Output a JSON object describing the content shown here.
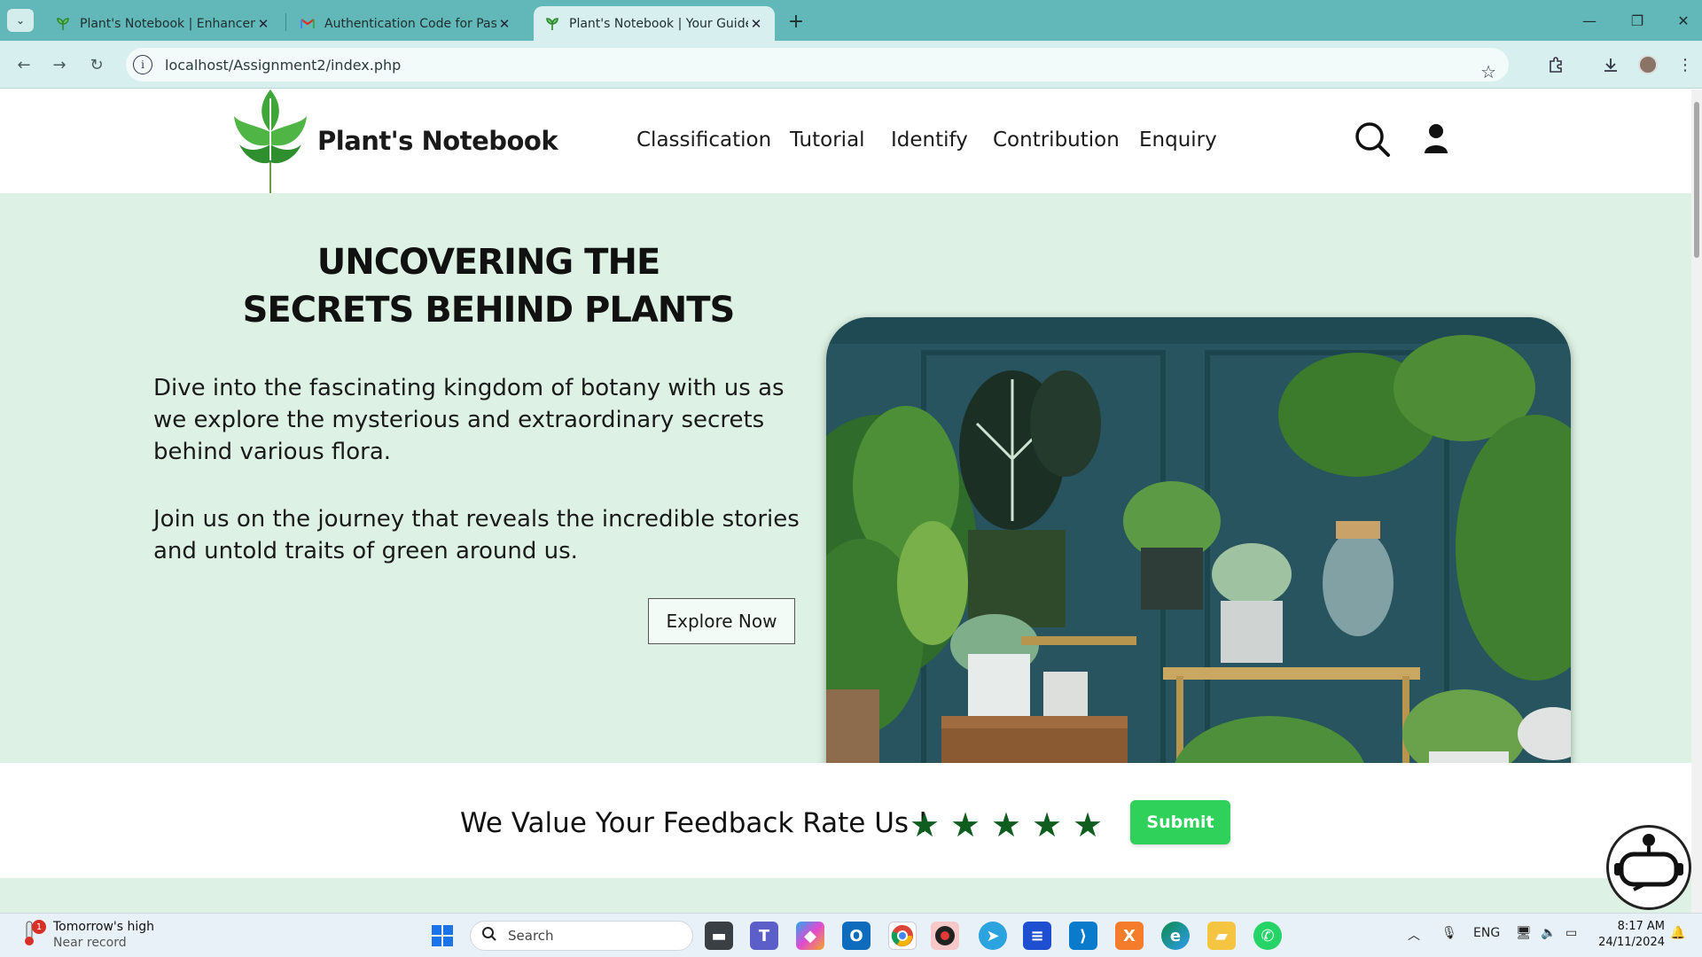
{
  "browser": {
    "tabs": [
      {
        "label": "Plant's Notebook | Enhanceme",
        "active": false,
        "icon": "plant-leaf-icon"
      },
      {
        "label": "Authentication Code for Passw",
        "active": false,
        "icon": "gmail-icon"
      },
      {
        "label": "Plant's Notebook | Your Guide t",
        "active": true,
        "icon": "plant-leaf-icon"
      }
    ],
    "url": "localhost/Assignment2/index.php"
  },
  "site": {
    "brand": "Plant's Notebook",
    "nav": [
      "Classification",
      "Tutorial",
      "Identify",
      "Contribution",
      "Enquiry"
    ],
    "hero": {
      "title_line1": "UNCOVERING THE",
      "title_line2": "SECRETS BEHIND PLANTS",
      "para1": "Dive into the fascinating kingdom of botany with us as we explore the mysterious and extraordinary secrets behind various flora.",
      "para2": "Join us on the journey that reveals the incredible stories and untold traits of green around us.",
      "cta": "Explore Now"
    },
    "feedback": {
      "text": "We Value Your Feedback Rate Us !",
      "stars": 5,
      "submit": "Submit"
    },
    "colors": {
      "hero_bg": "#ddf2e4",
      "star": "#0f5d1f",
      "submit_bg": "#2fd15a",
      "logo_green": "#3fa63a"
    }
  },
  "taskbar": {
    "weather_title": "Tomorrow's high",
    "weather_sub": "Near record",
    "weather_badge": "1",
    "search_label": "Search",
    "lang": "ENG",
    "time": "8:17 AM",
    "date": "24/11/2024"
  }
}
